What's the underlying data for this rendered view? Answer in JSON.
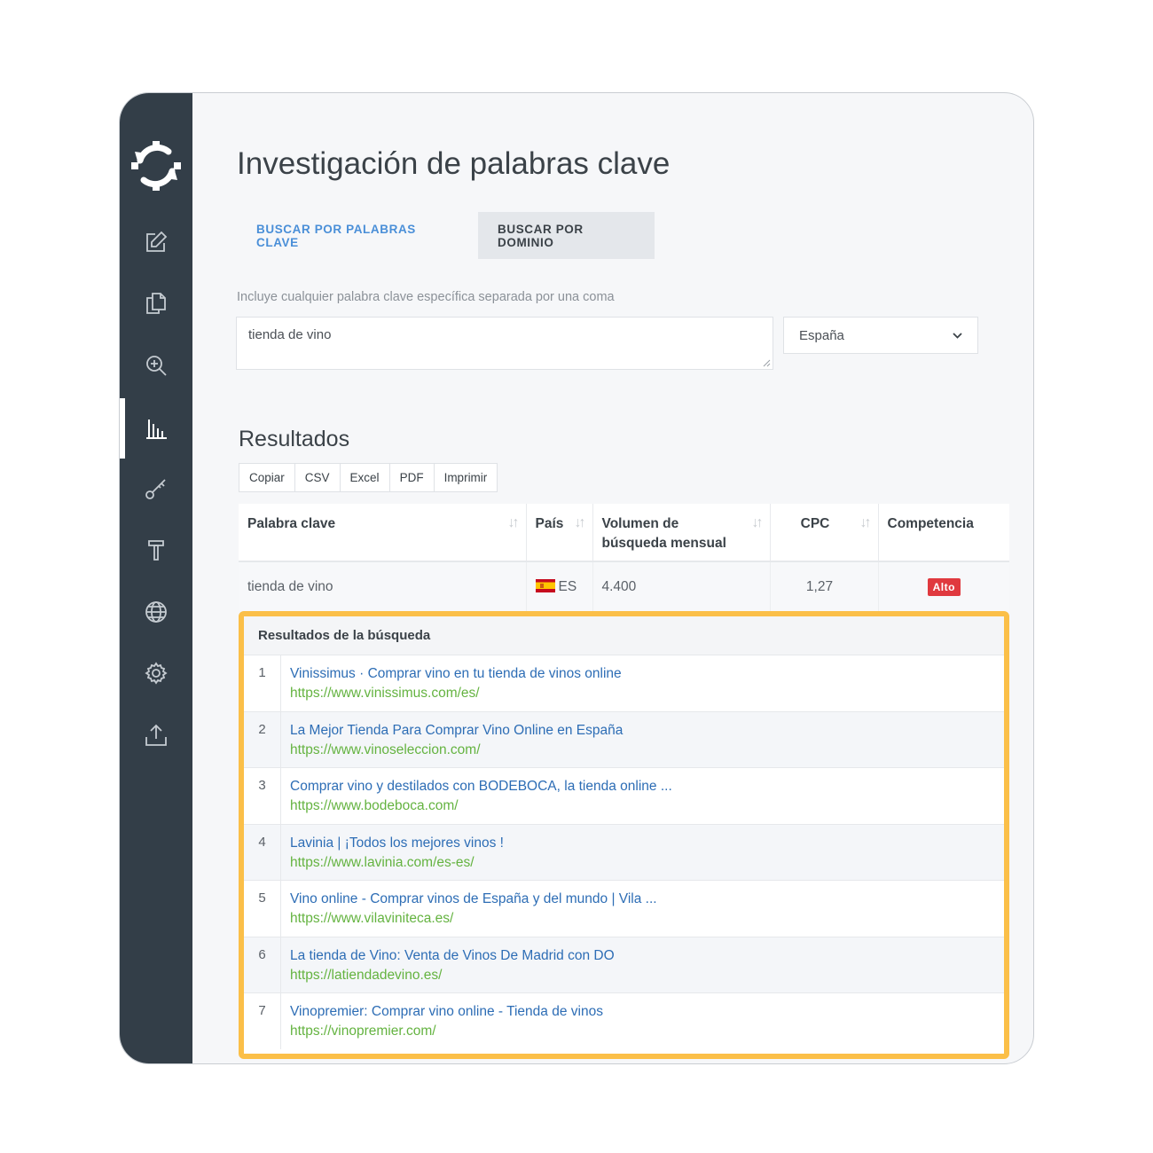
{
  "page": {
    "title": "Investigación de palabras clave"
  },
  "sidebar": {
    "items": [
      {
        "icon": "edit-icon"
      },
      {
        "icon": "copy-icon"
      },
      {
        "icon": "zoom-in-icon"
      },
      {
        "icon": "bar-chart-icon",
        "active": true
      },
      {
        "icon": "key-icon"
      },
      {
        "icon": "hammer-icon"
      },
      {
        "icon": "globe-icon"
      },
      {
        "icon": "gear-icon"
      },
      {
        "icon": "upload-icon"
      }
    ]
  },
  "tabs": [
    {
      "label": "BUSCAR POR PALABRAS CLAVE",
      "active": false
    },
    {
      "label": "BUSCAR POR DOMINIO",
      "active": true
    }
  ],
  "search": {
    "hint": "Incluye cualquier palabra clave específica separada por una coma",
    "value": "tienda de vino",
    "country": "España"
  },
  "results": {
    "title": "Resultados",
    "export_buttons": [
      "Copiar",
      "CSV",
      "Excel",
      "PDF",
      "Imprimir"
    ],
    "columns": [
      "Palabra clave",
      "País",
      "Volumen de búsqueda mensual",
      "CPC",
      "Competencia"
    ],
    "rows": [
      {
        "keyword": "tienda de vino",
        "country": "ES",
        "volume": "4.400",
        "cpc": "1,27",
        "competition": "Alto"
      }
    ]
  },
  "serp": {
    "title": "Resultados de la búsqueda",
    "items": [
      {
        "n": "1",
        "title": "Vinissimus · Comprar vino en tu tienda de vinos online",
        "url": "https://www.vinissimus.com/es/"
      },
      {
        "n": "2",
        "title": "La Mejor Tienda Para Comprar Vino Online en España",
        "url": "https://www.vinoseleccion.com/"
      },
      {
        "n": "3",
        "title": "Comprar vino y destilados con BODEBOCA, la tienda online ...",
        "url": "https://www.bodeboca.com/"
      },
      {
        "n": "4",
        "title": "Lavinia | ¡Todos los mejores vinos !",
        "url": "https://www.lavinia.com/es-es/"
      },
      {
        "n": "5",
        "title": "Vino online - Comprar vinos de España y del mundo | Vila ...",
        "url": "https://www.vilaviniteca.es/"
      },
      {
        "n": "6",
        "title": "La tienda de Vino: Venta de Vinos De Madrid con DO",
        "url": "https://latiendadevino.es/"
      },
      {
        "n": "7",
        "title": "Vinopremier: Comprar vino online - Tienda de vinos",
        "url": "https://vinopremier.com/"
      }
    ]
  },
  "colors": {
    "sidebar": "#333e48",
    "accent": "#4a8fd8",
    "link": "#2d6db5",
    "url": "#64b340",
    "highlight": "#fbbf48",
    "badge": "#e0393e"
  }
}
